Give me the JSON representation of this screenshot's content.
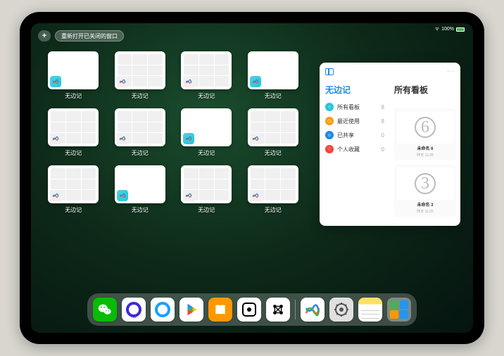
{
  "status": {
    "wifi": "᯾",
    "battery": "100%"
  },
  "top": {
    "plus": "+",
    "reopen_label": "重新打开已关闭的窗口"
  },
  "app_thumb_label": "无边记",
  "apps": [
    {
      "style": "blank"
    },
    {
      "style": "grid"
    },
    {
      "style": "grid"
    },
    {
      "style": "blank"
    },
    {
      "style": "grid"
    },
    {
      "style": "grid"
    },
    {
      "style": "blank"
    },
    {
      "style": "grid"
    },
    {
      "style": "grid"
    },
    {
      "style": "blank"
    },
    {
      "style": "grid"
    },
    {
      "style": "grid"
    }
  ],
  "panel": {
    "left_title": "无边记",
    "right_title": "所有看板",
    "dots": "···",
    "categories": [
      {
        "name": "所有看板",
        "count": "8",
        "color": "#26c6da",
        "symbol": "○"
      },
      {
        "name": "最近使用",
        "count": "8",
        "color": "#ff9800",
        "symbol": "◷"
      },
      {
        "name": "已共享",
        "count": "0",
        "color": "#1e88e5",
        "symbol": "☺"
      },
      {
        "name": "个人收藏",
        "count": "0",
        "color": "#f44336",
        "symbol": "♡"
      }
    ],
    "cards": [
      {
        "num": "6",
        "label": "未命名 6",
        "sub": "昨天 11:28"
      },
      {
        "num": "3",
        "label": "未命名 3",
        "sub": "昨天 11:25"
      }
    ]
  },
  "dock": {
    "items": [
      {
        "name": "wechat",
        "bg": "#09bb07",
        "glyph_color": "#fff"
      },
      {
        "name": "quark-hd",
        "bg": "#fff",
        "glyph_color": "#3b2bd9"
      },
      {
        "name": "quark",
        "bg": "#fff",
        "glyph_color": "#19a0ff"
      },
      {
        "name": "play",
        "bg": "#fff",
        "glyph_color": ""
      },
      {
        "name": "books",
        "bg": "#ff9800",
        "glyph_color": "#fff"
      },
      {
        "name": "dice",
        "bg": "#fff",
        "glyph_color": "#000"
      },
      {
        "name": "dots",
        "bg": "#fff",
        "glyph_color": "#000"
      }
    ],
    "recents": [
      {
        "name": "freeform",
        "bg": "#fff"
      },
      {
        "name": "settings",
        "bg": "#e0e0e0",
        "glyph_color": "#555"
      },
      {
        "name": "notes",
        "bg": "linear-gradient(#ffeb3b 30%,#fff 30%)"
      }
    ]
  }
}
